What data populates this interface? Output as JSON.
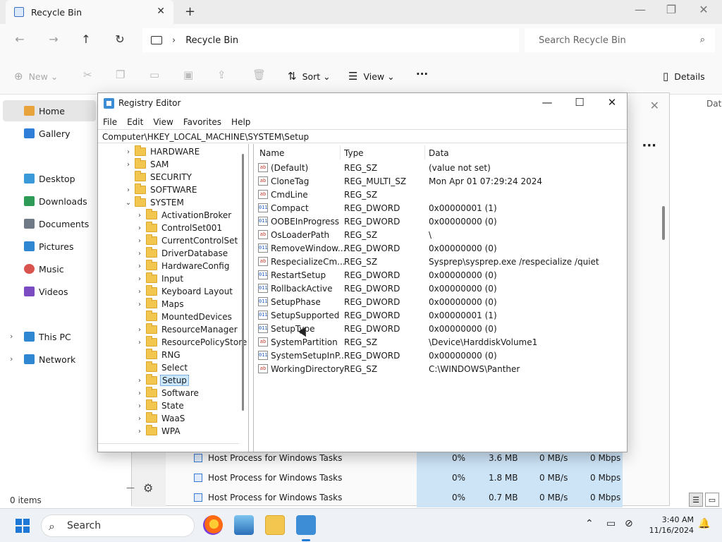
{
  "explorer": {
    "tab_title": "Recycle Bin",
    "tab_close": "✕",
    "new_tab": "+",
    "window_controls": [
      "—",
      "❐",
      "✕"
    ],
    "breadcrumb": "Recycle Bin",
    "breadcrumb_sep": "›",
    "search_placeholder": "Search Recycle Bin",
    "commands": {
      "new": "New",
      "sort": "Sort",
      "view": "View",
      "more": "···",
      "details": "Details"
    },
    "nav": [
      {
        "label": "Home",
        "color": "#e8a33c"
      },
      {
        "label": "Gallery",
        "color": "#2f7fd8"
      },
      {
        "label": "Desktop",
        "color": "#3a9ad9"
      },
      {
        "label": "Downloads",
        "color": "#2e9b57"
      },
      {
        "label": "Documents",
        "color": "#6f7a86"
      },
      {
        "label": "Pictures",
        "color": "#2f86d1"
      },
      {
        "label": "Music",
        "color": "#d9534f"
      },
      {
        "label": "Videos",
        "color": "#7b4bc2"
      },
      {
        "label": "This PC",
        "color": "#2f86d1"
      },
      {
        "label": "Network",
        "color": "#2f86d1"
      }
    ],
    "status": "0 items",
    "right_column": "Dat"
  },
  "taskmgr": {
    "rows": [
      {
        "name": "Host Process for Windows Tasks",
        "cpu": "0%",
        "mem": "3.6 MB",
        "disk": "0 MB/s",
        "net": "0 Mbps"
      },
      {
        "name": "Host Process for Windows Tasks",
        "cpu": "0%",
        "mem": "1.8 MB",
        "disk": "0 MB/s",
        "net": "0 Mbps"
      },
      {
        "name": "Host Process for Windows Tasks",
        "cpu": "0%",
        "mem": "0.7 MB",
        "disk": "0 MB/s",
        "net": "0 Mbps"
      }
    ]
  },
  "regedit": {
    "title": "Registry Editor",
    "menu": [
      "File",
      "Edit",
      "View",
      "Favorites",
      "Help"
    ],
    "path": "Computer\\HKEY_LOCAL_MACHINE\\SYSTEM\\Setup",
    "tree": [
      {
        "label": "HARDWARE",
        "level": 0,
        "chev": "›"
      },
      {
        "label": "SAM",
        "level": 0,
        "chev": "›"
      },
      {
        "label": "SECURITY",
        "level": 0,
        "chev": ""
      },
      {
        "label": "SOFTWARE",
        "level": 0,
        "chev": "›"
      },
      {
        "label": "SYSTEM",
        "level": 0,
        "chev": "⌄"
      },
      {
        "label": "ActivationBroker",
        "level": 1,
        "chev": "›"
      },
      {
        "label": "ControlSet001",
        "level": 1,
        "chev": "›"
      },
      {
        "label": "CurrentControlSet",
        "level": 1,
        "chev": "›"
      },
      {
        "label": "DriverDatabase",
        "level": 1,
        "chev": "›"
      },
      {
        "label": "HardwareConfig",
        "level": 1,
        "chev": "›"
      },
      {
        "label": "Input",
        "level": 1,
        "chev": "›"
      },
      {
        "label": "Keyboard Layout",
        "level": 1,
        "chev": "›"
      },
      {
        "label": "Maps",
        "level": 1,
        "chev": "›"
      },
      {
        "label": "MountedDevices",
        "level": 1,
        "chev": ""
      },
      {
        "label": "ResourceManager",
        "level": 1,
        "chev": "›"
      },
      {
        "label": "ResourcePolicyStore",
        "level": 1,
        "chev": "›"
      },
      {
        "label": "RNG",
        "level": 1,
        "chev": ""
      },
      {
        "label": "Select",
        "level": 1,
        "chev": ""
      },
      {
        "label": "Setup",
        "level": 1,
        "chev": "›",
        "selected": true
      },
      {
        "label": "Software",
        "level": 1,
        "chev": "›"
      },
      {
        "label": "State",
        "level": 1,
        "chev": "›"
      },
      {
        "label": "WaaS",
        "level": 1,
        "chev": "›"
      },
      {
        "label": "WPA",
        "level": 1,
        "chev": "›"
      }
    ],
    "columns": {
      "name": "Name",
      "type": "Type",
      "data": "Data"
    },
    "values": [
      {
        "name": "(Default)",
        "type": "REG_SZ",
        "data": "(value not set)",
        "icon": "ab"
      },
      {
        "name": "CloneTag",
        "type": "REG_MULTI_SZ",
        "data": "Mon Apr 01 07:29:24 2024",
        "icon": "ab"
      },
      {
        "name": "CmdLine",
        "type": "REG_SZ",
        "data": "",
        "icon": "ab"
      },
      {
        "name": "Compact",
        "type": "REG_DWORD",
        "data": "0x00000001 (1)",
        "icon": "011"
      },
      {
        "name": "OOBEInProgress",
        "type": "REG_DWORD",
        "data": "0x00000000 (0)",
        "icon": "011"
      },
      {
        "name": "OsLoaderPath",
        "type": "REG_SZ",
        "data": "\\",
        "icon": "ab"
      },
      {
        "name": "RemoveWindow...",
        "type": "REG_DWORD",
        "data": "0x00000000 (0)",
        "icon": "011"
      },
      {
        "name": "RespecializeCm...",
        "type": "REG_SZ",
        "data": "Sysprep\\sysprep.exe /respecialize /quiet",
        "icon": "ab"
      },
      {
        "name": "RestartSetup",
        "type": "REG_DWORD",
        "data": "0x00000000 (0)",
        "icon": "011"
      },
      {
        "name": "RollbackActive",
        "type": "REG_DWORD",
        "data": "0x00000000 (0)",
        "icon": "011"
      },
      {
        "name": "SetupPhase",
        "type": "REG_DWORD",
        "data": "0x00000000 (0)",
        "icon": "011"
      },
      {
        "name": "SetupSupported",
        "type": "REG_DWORD",
        "data": "0x00000001 (1)",
        "icon": "011"
      },
      {
        "name": "SetupType",
        "type": "REG_DWORD",
        "data": "0x00000000 (0)",
        "icon": "011"
      },
      {
        "name": "SystemPartition",
        "type": "REG_SZ",
        "data": "\\Device\\HarddiskVolume1",
        "icon": "ab"
      },
      {
        "name": "SystemSetupInP...",
        "type": "REG_DWORD",
        "data": "0x00000000 (0)",
        "icon": "011"
      },
      {
        "name": "WorkingDirectory",
        "type": "REG_SZ",
        "data": "C:\\WINDOWS\\Panther",
        "icon": "ab"
      }
    ]
  },
  "taskbar": {
    "search": "Search",
    "time": "3:40 AM",
    "date": "11/16/2024",
    "accent": "#1e78d6"
  }
}
